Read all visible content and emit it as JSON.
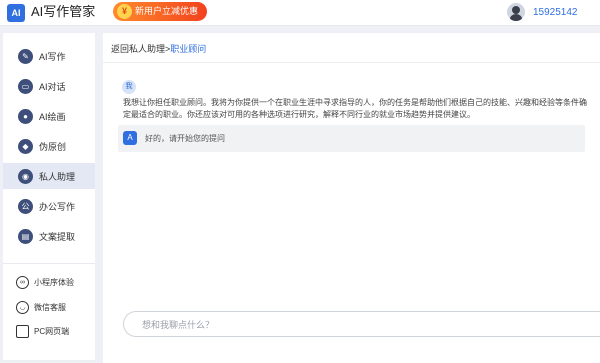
{
  "header": {
    "logo_text": "AI",
    "app_title": "AI写作管家",
    "promo_label": "新用户立减优惠",
    "user_id": "15925142"
  },
  "sidebar": {
    "items": [
      {
        "label": "AI写作",
        "icon": "pen-icon",
        "active": false
      },
      {
        "label": "AI对话",
        "icon": "chat-icon",
        "active": false
      },
      {
        "label": "AI绘画",
        "icon": "palette-icon",
        "active": false
      },
      {
        "label": "伪原创",
        "icon": "document-icon",
        "active": false
      },
      {
        "label": "私人助理",
        "icon": "assistant-icon",
        "active": true
      },
      {
        "label": "办公写作",
        "icon": "office-icon",
        "active": false
      },
      {
        "label": "文案提取",
        "icon": "folder-icon",
        "active": false
      }
    ],
    "bottom_items": [
      {
        "label": "小程序体验",
        "icon": "mini-program-icon"
      },
      {
        "label": "微信客服",
        "icon": "wechat-icon"
      },
      {
        "label": "PC网页端",
        "icon": "monitor-icon"
      }
    ]
  },
  "main": {
    "breadcrumb_back": "返回私人助理",
    "breadcrumb_separator": ">",
    "breadcrumb_current": "职业顾问",
    "user_badge": "我",
    "user_message": "我想让你担任职业顾问。我将为你提供一个在职业生涯中寻求指导的人，你的任务是帮助他们根据自己的技能、兴趣和经验等条件确定最适合的职业。你还应该对可用的各种选项进行研究，解释不同行业的就业市场趋势并提供建议。",
    "bot_reply": "好的，请开始您的提问",
    "input_placeholder": "想和我聊点什么？"
  },
  "colors": {
    "accent": "#2f6fe0",
    "nav_icon": "#3d4f7a",
    "active_bg": "#e3e8f4",
    "promo_start": "#ff8a2b",
    "promo_end": "#f2421e"
  }
}
